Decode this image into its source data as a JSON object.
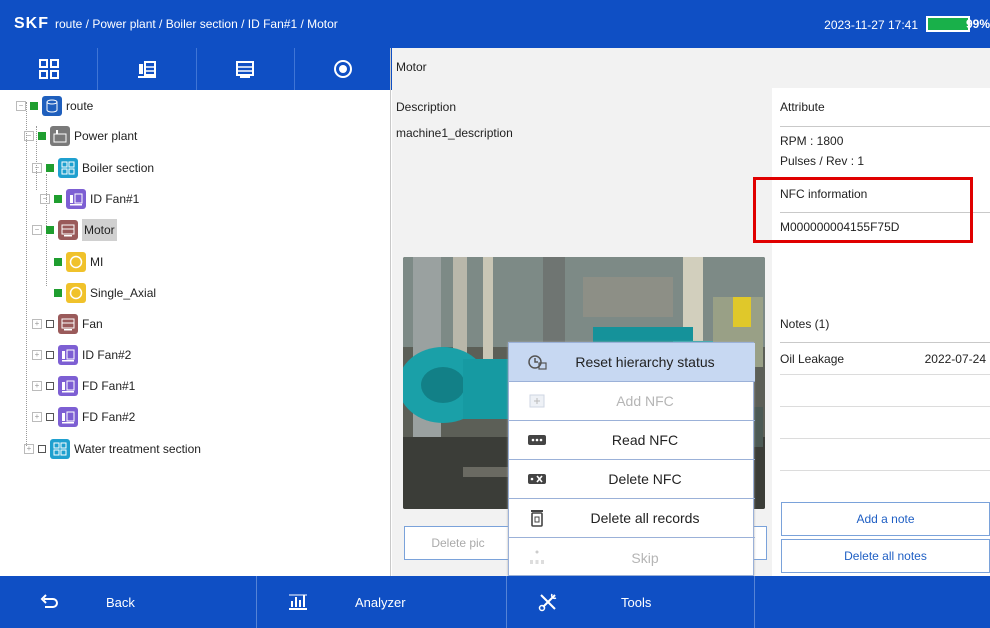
{
  "header": {
    "logo": "SKF",
    "breadcrumb": "route / Power plant / Boiler section / ID Fan#1 / Motor",
    "datetime": "2023-11-27 17:41",
    "battery": "99%"
  },
  "toolbar": {
    "buttons": [
      "grid-view-icon",
      "machine-icon",
      "component-icon",
      "record-icon"
    ]
  },
  "tree": [
    {
      "label": "route",
      "icon": "route-icon"
    },
    {
      "label": "Power plant",
      "icon": "plant-icon"
    },
    {
      "label": "Boiler section",
      "icon": "section-icon"
    },
    {
      "label": "ID Fan#1",
      "icon": "fan-icon"
    },
    {
      "label": "Motor",
      "icon": "motor-icon"
    },
    {
      "label": "MI",
      "icon": "point-icon"
    },
    {
      "label": "Single_Axial",
      "icon": "point-icon"
    },
    {
      "label": "Fan",
      "icon": "motor-icon"
    },
    {
      "label": "ID Fan#2",
      "icon": "fan-icon"
    },
    {
      "label": "FD Fan#1",
      "icon": "fan-icon"
    },
    {
      "label": "FD Fan#2",
      "icon": "fan-icon"
    },
    {
      "label": "Water treatment section",
      "icon": "section-icon"
    }
  ],
  "panel": {
    "title": "Motor",
    "description_label": "Description",
    "description_value": "machine1_description",
    "attribute_label": "Attribute",
    "rpm": "RPM : 1800",
    "pulses": "Pulses / Rev : 1",
    "nfc_label": "NFC information",
    "nfc_value": "M000000004155F75D",
    "notes_label": "Notes (1)",
    "note_text": "Oil Leakage",
    "note_date": "2022-07-24",
    "add_note": "Add a note",
    "delete_notes": "Delete all notes",
    "delete_picture": "Delete pic"
  },
  "context_menu": [
    {
      "label": "Reset hierarchy status",
      "icon": "reset-icon",
      "state": "active"
    },
    {
      "label": "Add NFC",
      "icon": "add-nfc-icon",
      "state": "disabled"
    },
    {
      "label": "Read NFC",
      "icon": "read-nfc-icon",
      "state": "normal"
    },
    {
      "label": "Delete NFC",
      "icon": "delete-nfc-icon",
      "state": "normal"
    },
    {
      "label": "Delete all records",
      "icon": "trash-icon",
      "state": "normal"
    },
    {
      "label": "Skip",
      "icon": "skip-icon",
      "state": "disabled"
    }
  ],
  "bottom": {
    "back": "Back",
    "analyzer": "Analyzer",
    "tools": "Tools"
  },
  "colors": {
    "brand_blue": "#0f4fc4",
    "status_green": "#1f9e2f",
    "highlight_red": "#e00000"
  }
}
